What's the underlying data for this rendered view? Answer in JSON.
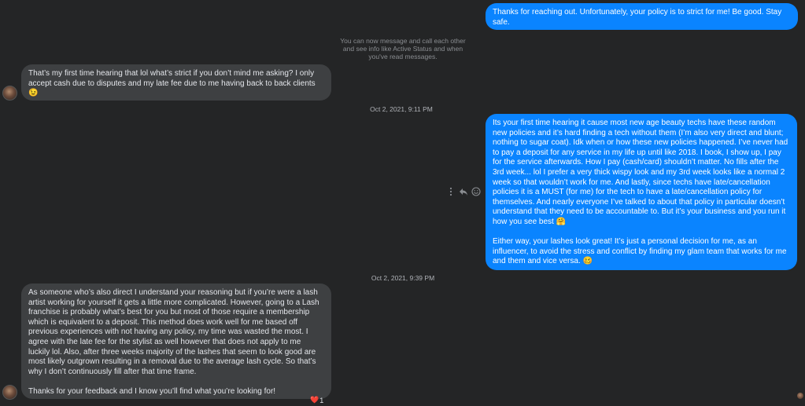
{
  "messages": [
    {
      "text": "Thanks for reaching out. Unfortunately, your policy is to strict for me! Be good. Stay safe."
    },
    {
      "text": "That’s my first time hearing that lol what’s strict if you don’t mind me asking? I only accept cash due to disputes and my late fee due to me having back to back clients 😉"
    },
    {
      "text": "Its your first time hearing it cause most new age beauty techs have these random new policies and it’s hard finding a tech without them (I’m also very direct and blunt; nothing to sugar coat). Idk when or how these new policies happened. I’ve never had to pay a deposit for any service in my life up until like 2018. I book, I show up, I pay for the service afterwards. How I pay (cash/card) shouldn’t matter. No fills after the 3rd week... lol I prefer a very thick wispy look and my 3rd week looks like a normal 2 week so that wouldn’t work for me. And lastly, since techs have late/cancellation policies it is a MUST (for me) for the tech to have a late/cancellation policy for themselves. And nearly everyone I’ve talked to about that policy in particular doesn’t understand that they need to be accountable to. But it’s your business and you run it how you see best 🤗\n\nEither way, your lashes look great! It’s just a personal decision for me, as an influencer, to avoid the stress and conflict by finding my glam team that works for me and them and vice versa. 🥴"
    },
    {
      "text": "As someone who’s also direct I understand your reasoning but if you’re were a lash artist working for yourself it gets a little more complicated. However, going to a Lash franchise is probably what’s best for you but most of those require a membership which is equivalent to a deposit. This method does work well for me based off previous experiences with not having any policy, my time was wasted the most. I agree with the late fee for the stylist as well however that does not apply to me luckily lol. Also, after three weeks majority of the lashes that seem to look good are most likely outgrown resulting in a removal due to the average lash cycle. So that’s why I don’t continuously fill after that time frame.\n\nThanks for your feedback and I know you’ll find what you’re looking for!"
    }
  ],
  "notice": "You can now message and call each other\nand see info like Active Status and when\nyou've read messages.",
  "timestamps": [
    "Oct 2, 2021, 9:11 PM",
    "Oct 2, 2021, 9:39 PM"
  ],
  "reaction": {
    "emoji": "❤️",
    "count": "1"
  },
  "icons": [
    "more-icon",
    "reply-icon",
    "emoji-icon"
  ],
  "colors": {
    "outgoing": "#0a84ff",
    "incoming": "#3e4042",
    "background": "#242526"
  }
}
